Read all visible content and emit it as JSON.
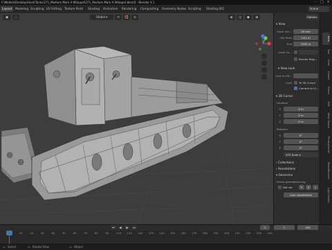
{
  "window": {
    "title": "F:\\Models\\Desktop\\Hunt\\Tanks\\271_Medium Mark A Whippet\\271_Medium Mark A Whippet.blend] - Blender 4.1"
  },
  "menu": {
    "tabs": [
      {
        "label": "Layout",
        "active": true
      },
      {
        "label": "Modeling"
      },
      {
        "label": "Sculpting"
      },
      {
        "label": "UV Editing"
      },
      {
        "label": "Texture Paint"
      },
      {
        "label": "Shading"
      },
      {
        "label": "Animation"
      },
      {
        "label": "Rendering"
      },
      {
        "label": "Compositing"
      },
      {
        "label": "Geometry Nodes"
      },
      {
        "label": "Scripting"
      },
      {
        "label": "Shading.001"
      }
    ],
    "scene": "Scene"
  },
  "viewport": {
    "orientation_label": "Global",
    "options_label": "Options",
    "colors": {
      "background": "#3d3d3d",
      "axis_x": "#e2434b",
      "axis_y": "#8ac241",
      "axis_z": "#3d7ce4",
      "model": "#9a9a9a"
    }
  },
  "npanel": {
    "view_section": "View",
    "focal_length": {
      "label": "Focal Len...",
      "value": "50 mm"
    },
    "clip_start": {
      "label": "Clip Start",
      "value": "0.01 m"
    },
    "clip_end": {
      "label": "End",
      "value": "1000 m"
    },
    "local_camera": {
      "label": "Local Ca..."
    },
    "render_region": "Render Regi...",
    "view_lock_section": "View Lock",
    "lock_to_object": {
      "label": "Lock to Ob..."
    },
    "lock_label": "Lock",
    "to_3d_cursor": "To 3D Cursor",
    "camera_to_view": "Camera to Vi...",
    "cursor_section": "3D Cursor",
    "location_label": "Location",
    "location": [
      {
        "axis": "X",
        "value": "0 m"
      },
      {
        "axis": "Y",
        "value": "0 m"
      },
      {
        "axis": "Z",
        "value": "0 m"
      }
    ],
    "rotation_label": "Rotation",
    "rotation": [
      {
        "axis": "X",
        "value": "0°"
      },
      {
        "axis": "Y",
        "value": "0°"
      },
      {
        "axis": "Z",
        "value": "0°"
      }
    ],
    "rotation_mode": "XYZ Euler",
    "collections": "Collections",
    "annotations": "Annotations",
    "geoscene": "Geoscene",
    "geo_label": "Scene georeferencing",
    "geo_not_set": "Not set",
    "geo_buttons": "",
    "user_coordinates": "User coordinates"
  },
  "vtabs": [
    "Item",
    "Tool",
    "View",
    "Create",
    "Fluent",
    "Edit",
    "Mesh Shape",
    "Photographer",
    "MeshMachine",
    "Light Studio"
  ],
  "timeline": {
    "current_frame": "1",
    "start_frame": "1",
    "end_frame": "250",
    "ticks": [
      "0",
      "10",
      "20",
      "30",
      "40",
      "50",
      "60",
      "70",
      "80",
      "90",
      "100",
      "110",
      "120",
      "130",
      "140",
      "150",
      "160",
      "170",
      "180",
      "190",
      "200",
      "210",
      "220",
      "230",
      "240"
    ]
  },
  "status": {
    "left": "Select",
    "middle": "Rotate View",
    "right": "Object",
    "search": ""
  }
}
